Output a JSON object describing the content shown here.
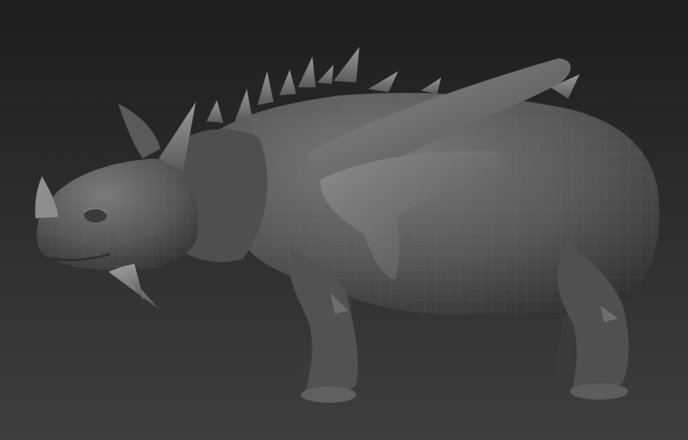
{
  "viewport": {
    "background_top": "#1d1d1d",
    "background_bottom": "#3e3e3e",
    "material_color": "#5e5e5e",
    "wire_color": "#7a7a7a"
  },
  "model": {
    "icon": "sculpt-model"
  }
}
